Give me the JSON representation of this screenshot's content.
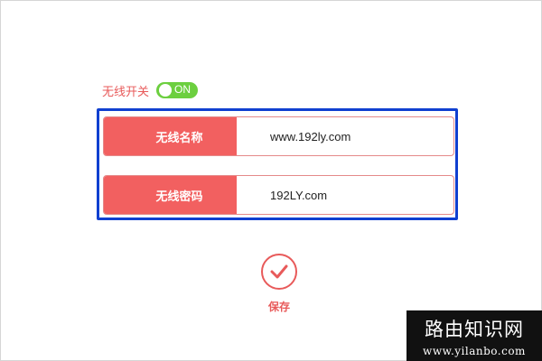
{
  "wifi_switch": {
    "label": "无线开关",
    "state_text": "ON",
    "color": "#6ccf3f"
  },
  "form": {
    "ssid": {
      "label": "无线名称",
      "value": "www.192ly.com"
    },
    "password": {
      "label": "无线密码",
      "value": "192LY.com"
    }
  },
  "save": {
    "label": "保存",
    "icon": "checkmark-icon"
  },
  "watermark": {
    "title": "路由知识网",
    "url": "www.yilanbo.com"
  },
  "colors": {
    "accent": "#f26060",
    "highlight": "#1040d0"
  }
}
